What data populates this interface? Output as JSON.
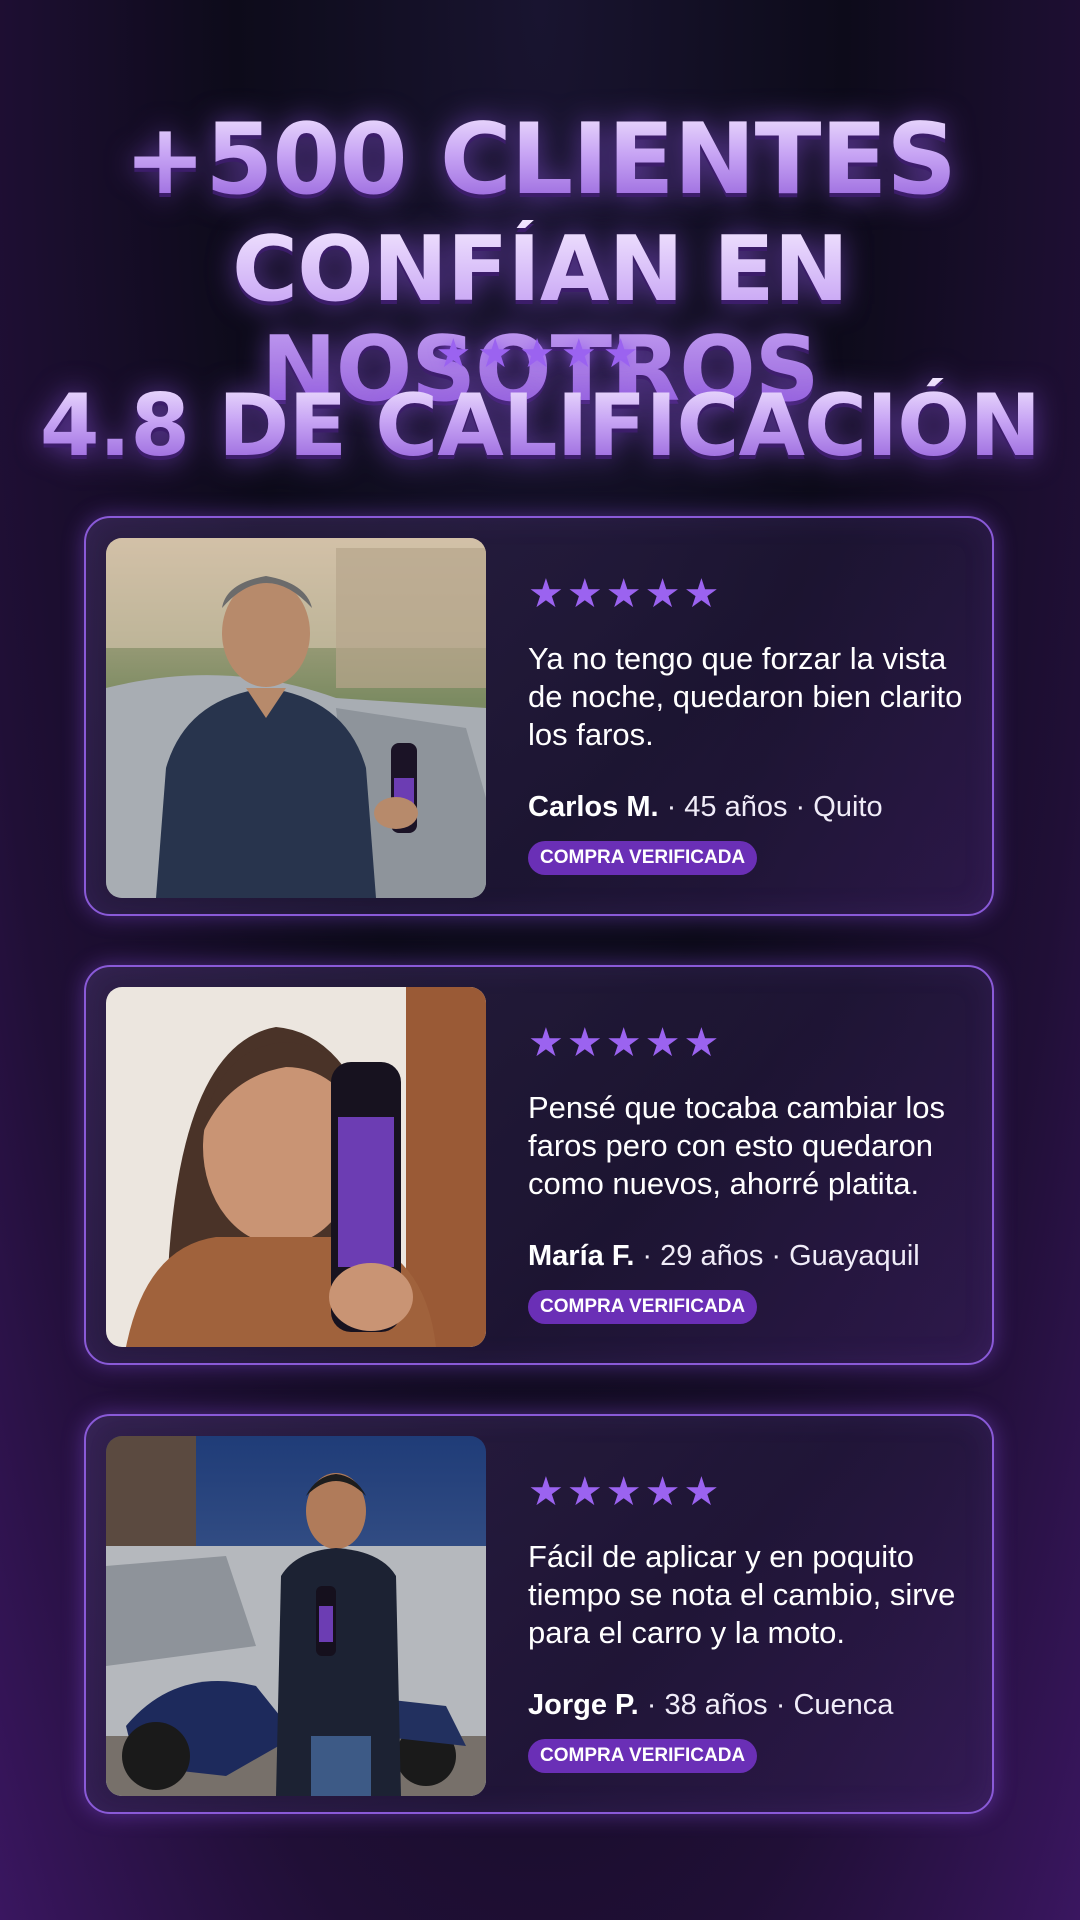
{
  "header": {
    "line1": "+500 CLIENTES",
    "line2": "CONFÍAN EN NOSOTROS",
    "stars": "★★★★★",
    "line3": "4.8 DE CALIFICACIÓN",
    "rating": 4.8
  },
  "colors": {
    "accent": "#9b63f0",
    "badge": "#6a2fb6",
    "border": "#8a5ad8"
  },
  "reviews": [
    {
      "stars": "★★★★★",
      "rating": 5,
      "text": "Ya no tengo que forzar la vista de noche, quedaron bien clarito los faros.",
      "name": "Carlos M.",
      "details": " · 45 años · Quito",
      "badge": "COMPRA VERIFICADA",
      "photo_icon": "customer-photo-man-car"
    },
    {
      "stars": "★★★★★",
      "rating": 5,
      "text": "Pensé que tocaba cambiar los faros pero con esto quedaron como nuevos, ahorré platita.",
      "name": "María F.",
      "details": " · 29 años · Guayaquil",
      "badge": "COMPRA VERIFICADA",
      "photo_icon": "customer-photo-woman-selfie"
    },
    {
      "stars": "★★★★★",
      "rating": 5,
      "text": "Fácil de aplicar y en poquito tiempo se nota el cambio, sirve para el carro y la moto.",
      "name": "Jorge P.",
      "details": " · 38 años · Cuenca",
      "badge": "COMPRA VERIFICADA",
      "photo_icon": "customer-photo-man-motorcycle"
    }
  ]
}
